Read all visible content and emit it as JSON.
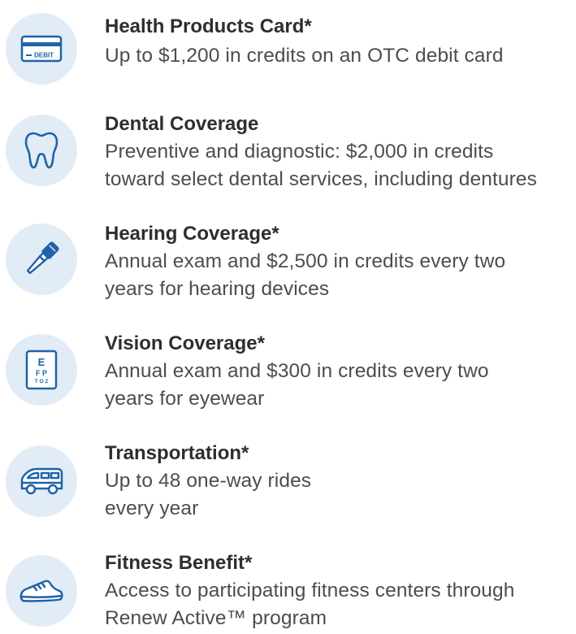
{
  "benefits": [
    {
      "icon": "debit-card-icon",
      "title": "Health Products Card*",
      "lines": [
        "Up to $1,200 in credits on an OTC debit card"
      ],
      "card_label": "DEBIT"
    },
    {
      "icon": "tooth-icon",
      "title": "Dental Coverage",
      "lines": [
        "Preventive and diagnostic: $2,000 in credits",
        "toward select dental services, including dentures"
      ]
    },
    {
      "icon": "otoscope-icon",
      "title": "Hearing Coverage*",
      "lines": [
        "Annual exam and $2,500 in credits every two",
        "years for hearing devices"
      ]
    },
    {
      "icon": "eye-chart-icon",
      "title": "Vision Coverage*",
      "lines": [
        "Annual exam and $300 in credits every two",
        "years for eyewear"
      ],
      "chart_rows": [
        "E",
        "F P",
        "T O Z"
      ]
    },
    {
      "icon": "van-icon",
      "title": "Transportation*",
      "lines": [
        "Up to 48 one-way rides",
        "every year"
      ]
    },
    {
      "icon": "sneaker-icon",
      "title": "Fitness Benefit*",
      "lines": [
        "Access to participating fitness centers through",
        "Renew Active™ program"
      ]
    }
  ],
  "colors": {
    "icon_bg": "#e1ecf7",
    "icon_stroke": "#1f63a8",
    "title": "#2e2e2e",
    "body": "#4d4d4d"
  }
}
